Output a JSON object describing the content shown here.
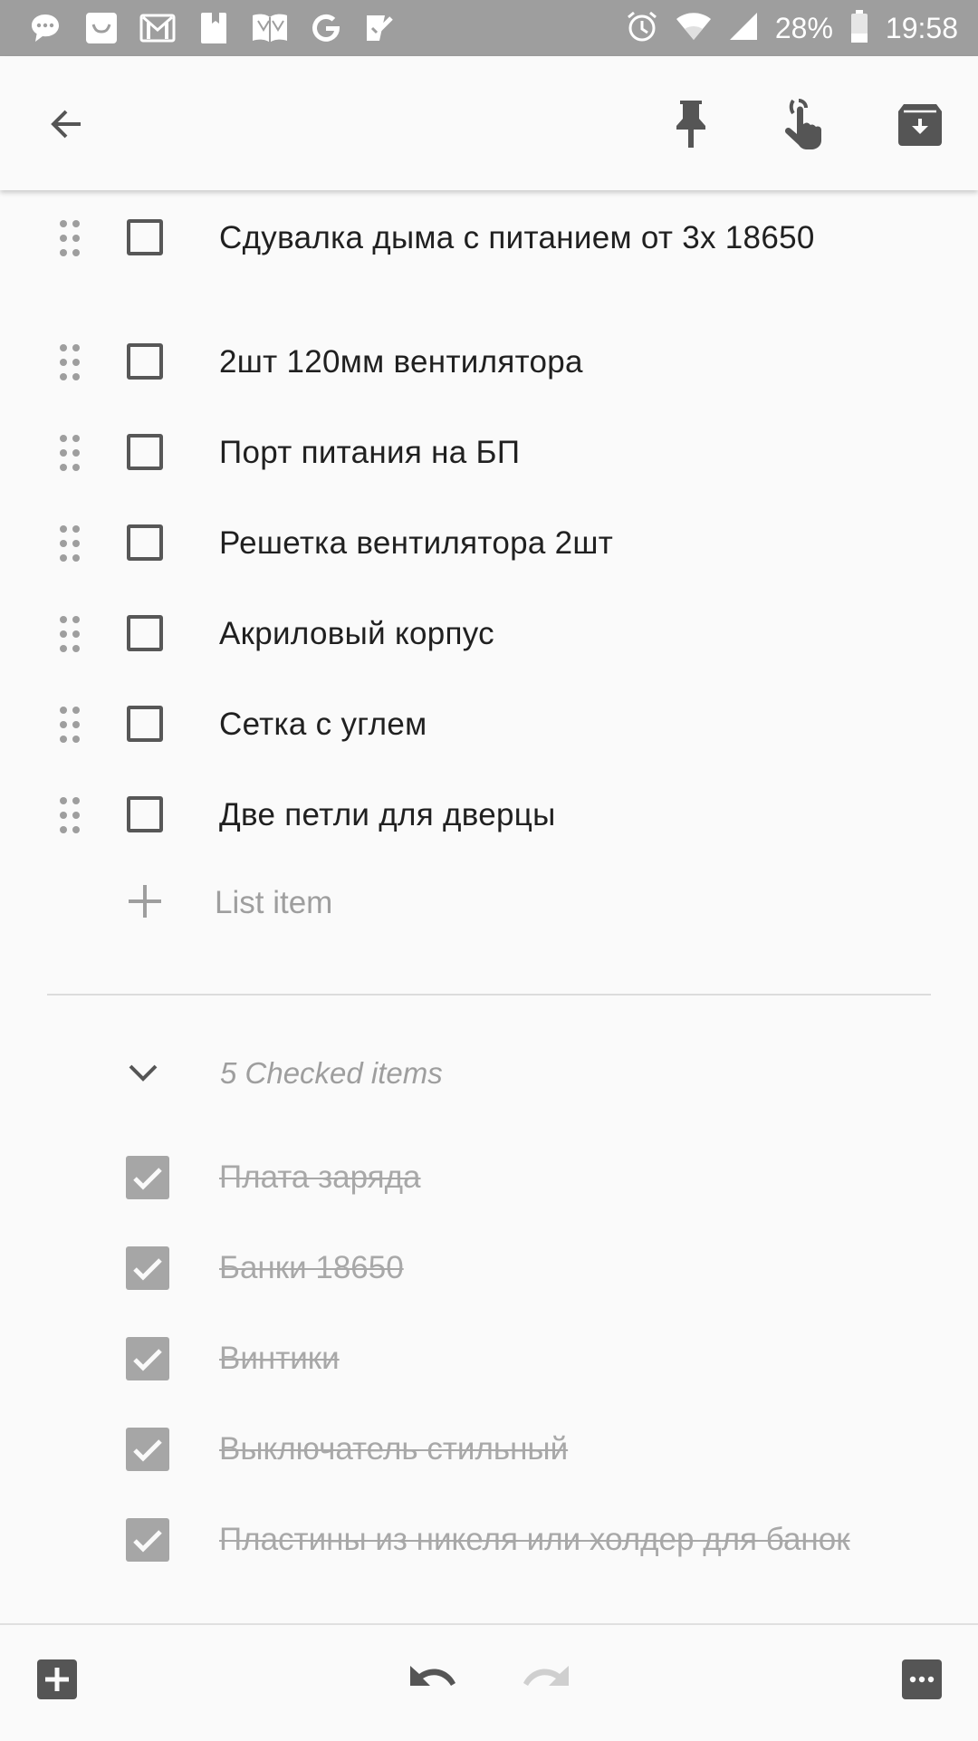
{
  "status_bar": {
    "battery_percent": "28%",
    "time": "19:58",
    "left_icons": [
      "chat-bubble-icon",
      "smile-bag-icon",
      "gmail-icon",
      "bookmark-icon",
      "book-icon",
      "google-icon",
      "checkmark-app-icon"
    ],
    "right_icons": [
      "alarm-icon",
      "wifi-icon",
      "signal-icon",
      "battery-icon"
    ]
  },
  "toolbar": {
    "icons": [
      "back-arrow-icon",
      "pin-icon",
      "reminder-icon",
      "archive-icon"
    ]
  },
  "unchecked_items": [
    {
      "text": "Сдувалка дыма с питанием от 3х 18650"
    },
    {
      "text": "2шт 120мм вентилятора"
    },
    {
      "text": "Порт питания на БП"
    },
    {
      "text": "Решетка вентилятора 2шт"
    },
    {
      "text": "Акриловый корпус"
    },
    {
      "text": "Сетка с углем"
    },
    {
      "text": "Две петли для дверцы"
    }
  ],
  "add_item": {
    "placeholder": "List item"
  },
  "checked_section": {
    "label": "5 Checked items"
  },
  "checked_items": [
    {
      "text": "Плата заряда"
    },
    {
      "text": "Банки 18650"
    },
    {
      "text": "Винтики"
    },
    {
      "text": "Выключатель стильный"
    },
    {
      "text": "Пластины из никеля или холдер для банок"
    }
  ],
  "bottom_bar": {
    "icons": [
      "add-box-icon",
      "undo-icon",
      "redo-icon",
      "more-icon"
    ]
  },
  "colors": {
    "status_bar": "#9e9e9e",
    "background": "#fafafa",
    "text": "#202020",
    "muted": "#9e9e9e"
  }
}
